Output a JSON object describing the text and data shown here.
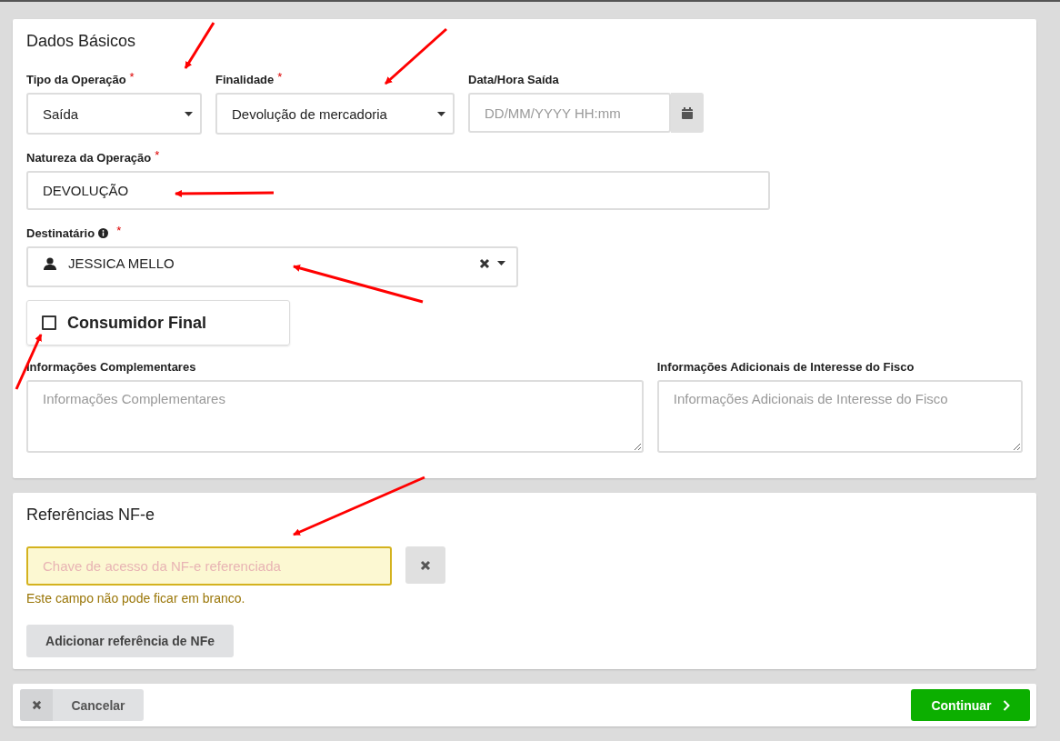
{
  "basic": {
    "title": "Dados Básicos",
    "rows": [
      [
        {
          "kind": "select",
          "label": "Tipo da Operação",
          "required_mark": "*",
          "value": "Saída"
        },
        {
          "kind": "select",
          "label": "Finalidade",
          "required_mark": "*",
          "value": "Devolução de mercadoria"
        },
        {
          "kind": "datetime",
          "label": "Data/Hora Saída",
          "placeholder": "DD/MM/YYYY HH:mm"
        }
      ],
      [
        {
          "kind": "text",
          "label": "Natureza da Operação",
          "required_mark": "*",
          "value": "DEVOLUÇÃO"
        }
      ],
      [
        {
          "kind": "person",
          "label": "Destinatário",
          "required_mark": "*",
          "info": true,
          "value": "JESSICA MELLO"
        }
      ],
      [
        {
          "kind": "checkbox",
          "label": "Consumidor Final",
          "checked": false
        }
      ],
      [
        {
          "kind": "textarea",
          "label": "Informações Complementares",
          "placeholder": "Informações Complementares"
        },
        {
          "kind": "textarea",
          "label": "Informações Adicionais de Interesse do Fisco",
          "placeholder": "Informações Adicionais de Interesse do Fisco"
        }
      ]
    ]
  },
  "references": {
    "title": "Referências NF-e",
    "field": {
      "placeholder": "Chave de acesso da NF-e referenciada",
      "invalid": true,
      "error": "Este campo não pode ficar em branco."
    },
    "add_button": "Adicionar referência de NFe"
  },
  "footer": {
    "buttons": [
      {
        "kind": "cancel",
        "label": "Cancelar"
      },
      {
        "kind": "continue",
        "label": "Continuar"
      }
    ]
  }
}
